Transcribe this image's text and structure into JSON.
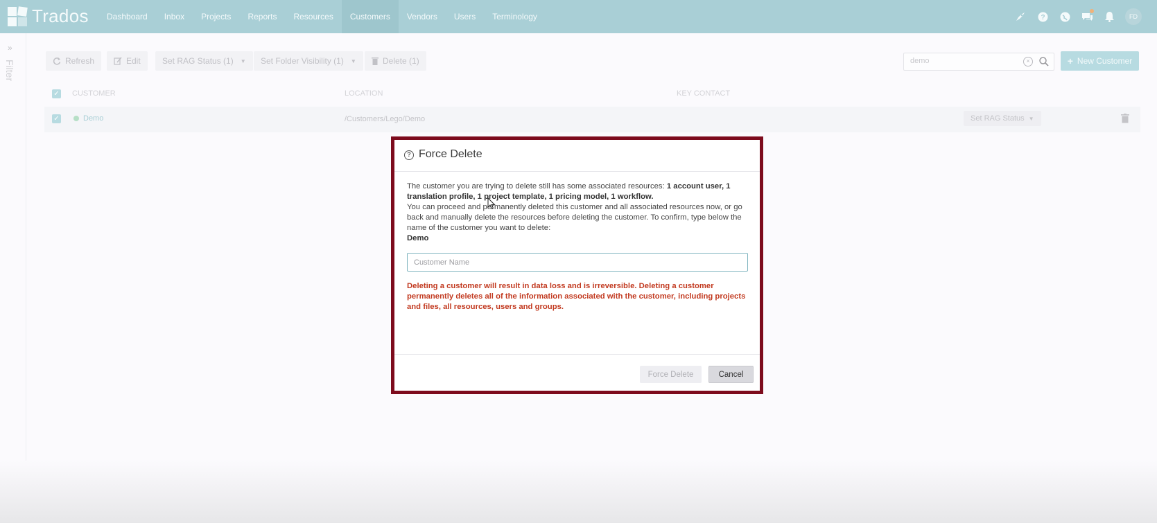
{
  "app": {
    "name": "Trados",
    "nav": [
      "Dashboard",
      "Inbox",
      "Projects",
      "Reports",
      "Resources",
      "Customers",
      "Vendors",
      "Users",
      "Terminology"
    ],
    "active_nav": "Customers",
    "user_initials": "FD"
  },
  "filter": {
    "label": "Filter"
  },
  "toolbar": {
    "refresh": "Refresh",
    "edit": "Edit",
    "set_rag": "Set RAG Status (1)",
    "set_folder": "Set Folder Visibility (1)",
    "delete": "Delete (1)",
    "search_value": "demo",
    "new_customer": "New Customer"
  },
  "table": {
    "headers": {
      "customer": "CUSTOMER",
      "location": "LOCATION",
      "key_contact": "KEY CONTACT"
    },
    "rows": [
      {
        "name": "Demo",
        "location": "/Customers/Lego/Demo",
        "rag_button": "Set RAG Status"
      }
    ]
  },
  "modal": {
    "title": "Force Delete",
    "intro": "The customer you are trying to delete still has some associated resources: ",
    "resources": "1 account user, 1 translation profile, 1 project template, 1 pricing model, 1 workflow.",
    "instructions": "You can proceed and permanently deleted this customer and all associated resources now, or go back and manually delete the resources before deleting the customer. To confirm, type below the name of the customer you want to delete:",
    "customer_name": "Demo",
    "input_placeholder": "Customer Name",
    "warning": "Deleting a customer will result in data loss and is irreversible. Deleting a customer permanently deletes all of the information associated with the customer, including projects and files, all resources, users and groups.",
    "force_delete": "Force Delete",
    "cancel": "Cancel"
  },
  "colors": {
    "nav_bg": "#a9cfd6",
    "modal_border": "#7d0b1d",
    "warning_text": "#c23a20",
    "accent": "#b7dbe1"
  }
}
